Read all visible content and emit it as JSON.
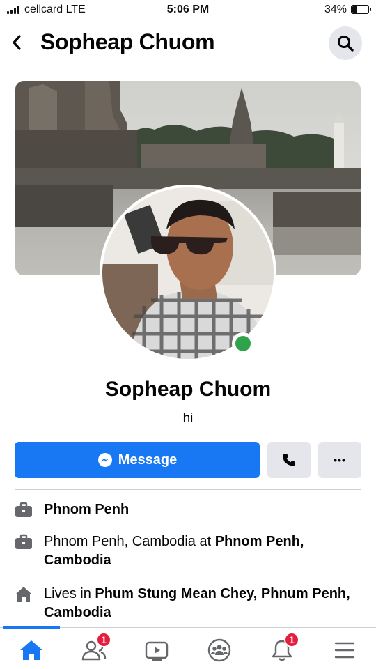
{
  "status_bar": {
    "carrier": "cellcard  LTE",
    "time": "5:06 PM",
    "battery": "34%",
    "battery_level": 0.34
  },
  "header": {
    "title": "Sopheap Chuom",
    "back_icon": "chevron-left-icon",
    "search_icon": "search-icon"
  },
  "profile": {
    "name": "Sopheap Chuom",
    "bio": "hi",
    "online": true
  },
  "actions": {
    "message_label": "Message",
    "call_icon": "phone-icon",
    "more_label": "•••"
  },
  "intro": [
    {
      "icon": "briefcase-icon",
      "text": "",
      "bold": "Phnom Penh"
    },
    {
      "icon": "briefcase-icon",
      "text": "Phnom Penh, Cambodia at ",
      "bold": "Phnom Penh, Cambodia"
    },
    {
      "icon": "home-icon",
      "text": "Lives in ",
      "bold": "Phum Stung Mean Chey, Phnum Penh, Cambodia"
    }
  ],
  "bottom_nav": {
    "friends_badge": "1",
    "notifications_badge": "1"
  },
  "colors": {
    "accent": "#1877f2",
    "online": "#31a24c",
    "badge": "#e41e3f"
  }
}
